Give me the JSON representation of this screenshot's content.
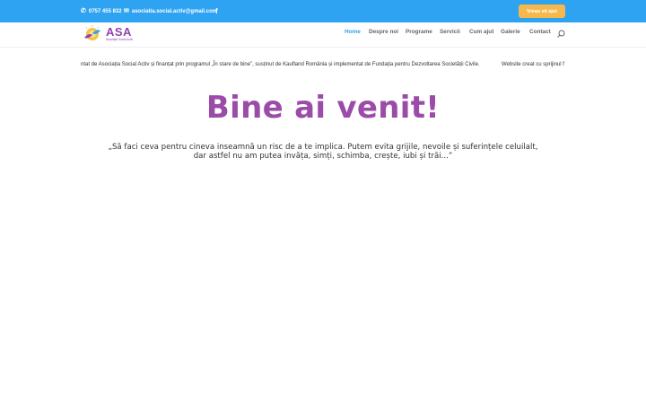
{
  "topbar": {
    "phone": "0757 455 832",
    "email": "asociatia.social.activ@gmail.com",
    "cta_label": "Vreau să ajut",
    "colors": {
      "background": "#2ea3f2",
      "cta": "#f5b84c"
    }
  },
  "header": {
    "logo": {
      "title": "ASA",
      "subtitle": "Asociația Social Activ"
    },
    "nav": [
      {
        "label": "Home",
        "active": true
      },
      {
        "label": "Despre noi",
        "active": false
      },
      {
        "label": "Programe",
        "active": false
      },
      {
        "label": "Servicii",
        "active": false
      },
      {
        "label": "Cum ajut",
        "active": false
      },
      {
        "label": "Galerie",
        "active": false
      },
      {
        "label": "Contact",
        "active": false
      }
    ],
    "search_icon": "search-icon"
  },
  "ticker": {
    "text_1": "ntat de Asociația Social Activ și finanțat prin programul „În stare de bine”, susținut de Kaufland România și implementat de Fundația pentru Dezvoltarea Societății Civile.",
    "text_2": "Website creat cu sprijinul f"
  },
  "hero": {
    "title": "Bine ai venit!",
    "quote_line1": "„Să faci ceva pentru cineva inseamnă un risc de a te implica. Putem evita grijile, nevoile și suferințele celuilalt,",
    "quote_line2": "dar astfel nu am putea invăța, simți, schimba, crește, iubi și trăi...”",
    "title_color": "#9b4ca8"
  }
}
